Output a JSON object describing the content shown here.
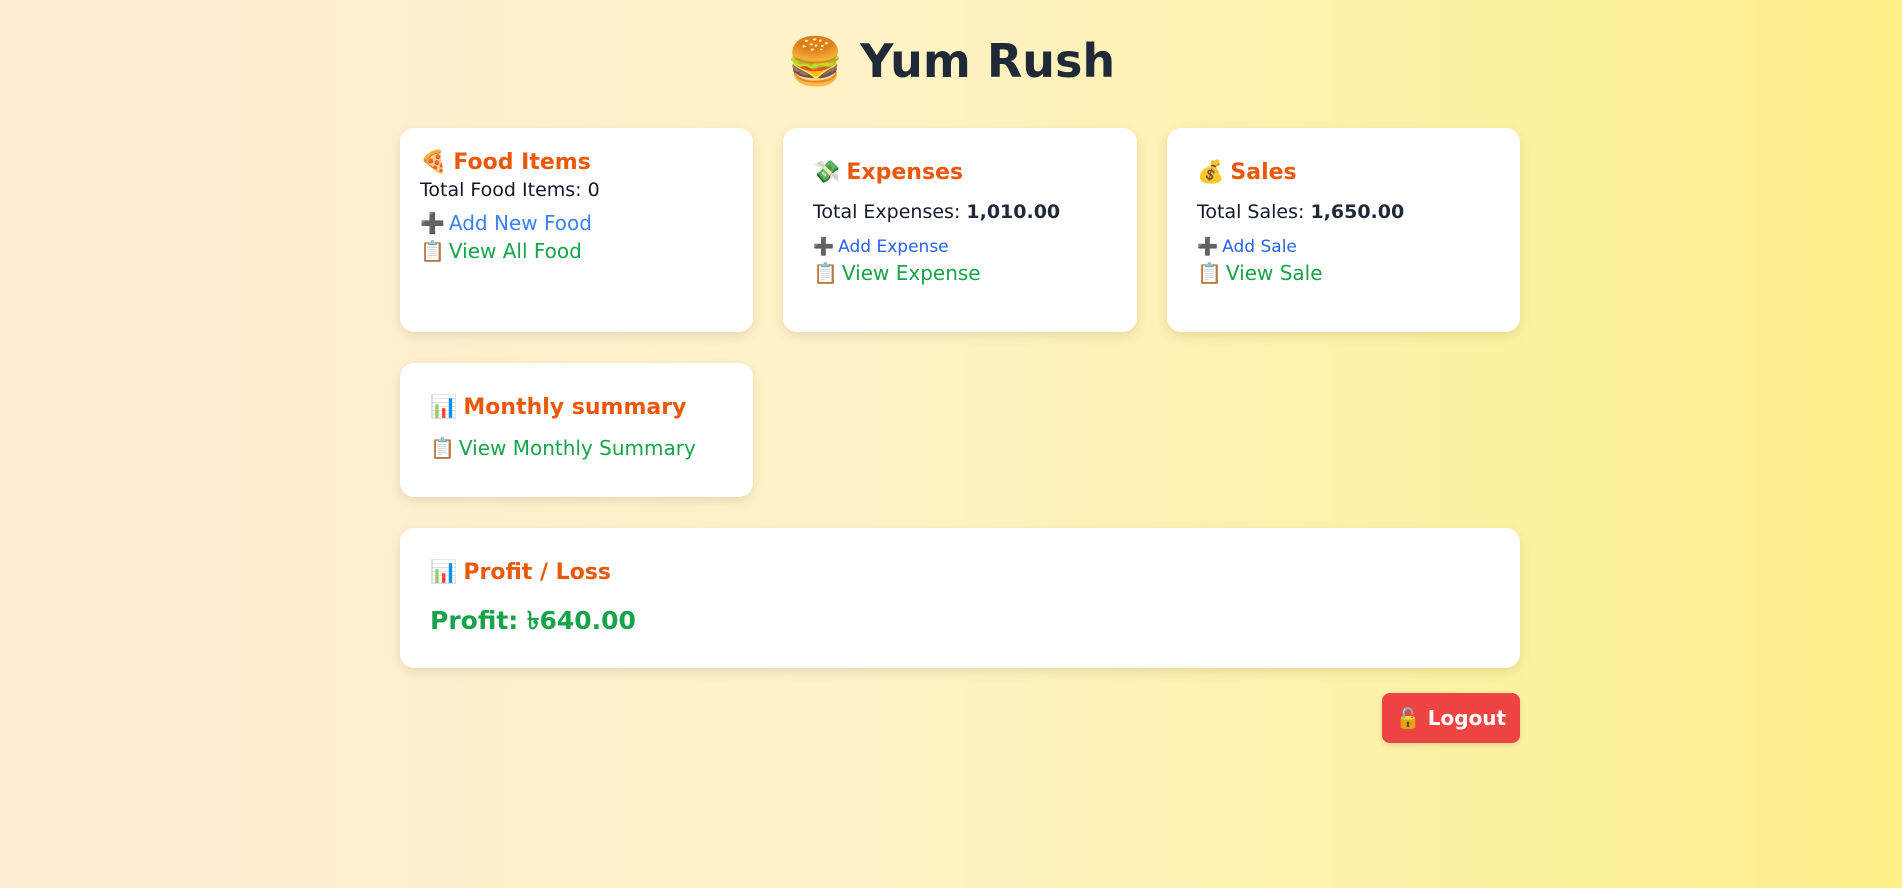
{
  "app": {
    "icon": "burger-icon",
    "icon_glyph": "🍔",
    "title": "Yum Rush"
  },
  "food": {
    "icon_glyph": "🍕",
    "title": "Food Items",
    "total_label": "Total Food Items:",
    "total_value": "0",
    "add_icon": "➕",
    "add_label": "Add New Food",
    "view_icon": "📋",
    "view_label": "View All Food"
  },
  "expenses": {
    "icon_glyph": "💸",
    "title": "Expenses",
    "total_label": "Total Expenses:",
    "total_value": "1,010.00",
    "add_icon": "➕",
    "add_label": "Add Expense",
    "view_icon": "📋",
    "view_label": "View Expense"
  },
  "sales": {
    "icon_glyph": "💰",
    "title": "Sales",
    "total_label": "Total Sales:",
    "total_value": "1,650.00",
    "add_icon": "➕",
    "add_label": "Add Sale",
    "view_icon": "📋",
    "view_label": "View Sale"
  },
  "monthly": {
    "icon_glyph": "📊",
    "title": "Monthly summary",
    "view_icon": "📋",
    "view_label": "View Monthly Summary"
  },
  "profit": {
    "icon_glyph": "📊",
    "title": "Profit / Loss",
    "value": "Profit: ৳640.00"
  },
  "logout": {
    "icon_glyph": "🔓",
    "label": "Logout"
  },
  "colors": {
    "accent": "#ea580c",
    "link_blue": "#3b82f6",
    "link_green": "#16a34a",
    "profit": "#16a34a",
    "logout": "#ef4444"
  }
}
